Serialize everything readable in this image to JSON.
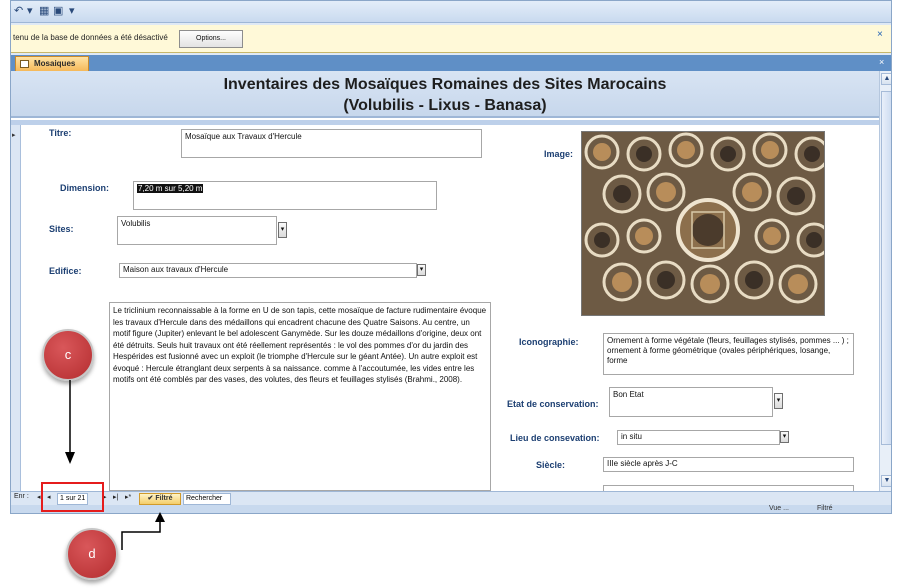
{
  "quick_access": {
    "icons": [
      "undo-icon",
      "dropdown-icon",
      "save-icon"
    ]
  },
  "message_bar": {
    "text": "tenu de la base de données a été désactivé",
    "options_label": "Options...",
    "close": "×"
  },
  "document_tab": {
    "label": "Mosaiques",
    "close": "×"
  },
  "header": {
    "title_line1": "Inventaires des Mosaïques Romaines des Sites Marocains",
    "title_line2": "(Volubilis - Lixus - Banasa)"
  },
  "fields": {
    "titre": {
      "label": "Titre:",
      "value": "Mosaïque aux Travaux d'Hercule"
    },
    "dimension": {
      "label": "Dimension:",
      "value": "7,20 m sur 5,20 m"
    },
    "sites": {
      "label": "Sites:",
      "value": "Volubilis"
    },
    "edifice": {
      "label": "Edifice:",
      "value": "Maison aux travaux d'Hercule"
    },
    "description": {
      "value": "Le triclinium  reconnaissable à la forme en U de son tapis, cette mosaïque de facture rudimentaire évoque les travaux d'Hercule dans des médaillons qui encadrent chacune des Quatre Saisons. Au centre, un motif figure (Jupiter) enlevant le bel adolescent Ganymède. Sur les douze médaillons d'origine, deux ont été détruits. Seuls huit travaux ont été réellement représentés : le vol des pommes d'or du jardin des Hespérides est fusionné avec un exploit (le triomphe d'Hercule sur le géant Antée). Un autre exploit est évoqué : Hercule étranglant deux serpents à sa naissance. comme à l'accoutumée, les vides entre les motifs ont été comblés par des vases, des volutes, des fleurs et feuillages stylisés (Brahmi., 2008)."
    },
    "image": {
      "label": "Image:"
    },
    "iconographie": {
      "label": "Iconographie:",
      "value": "Ornement à forme végétale (fleurs, feuillages stylisés, pommes ... ) ; ornement à forme géométrique (ovales périphériques, losange, forme"
    },
    "etat": {
      "label": "Etat de conservation:",
      "value": "Bon Etat"
    },
    "lieu": {
      "label": "Lieu de consevation:",
      "value": "in situ"
    },
    "siecle": {
      "label": "Siècle:",
      "value": "IIIe siècle après  J-C"
    }
  },
  "navbar": {
    "prefix": "Enr :",
    "first": "◂",
    "prev": "◂",
    "record": "1 sur 21",
    "next": "▸",
    "last": "▸|",
    "new": "▸*",
    "filter": "Filtré",
    "search": "Rechercher"
  },
  "status": {
    "view": "Vue ...",
    "filtered": "Filtré"
  },
  "annotations": {
    "c": "c",
    "d": "d"
  },
  "colors": {
    "annotation_red": "#e51c1c",
    "circle_fill": "#c03a3c",
    "label_blue": "#1c3f72"
  }
}
